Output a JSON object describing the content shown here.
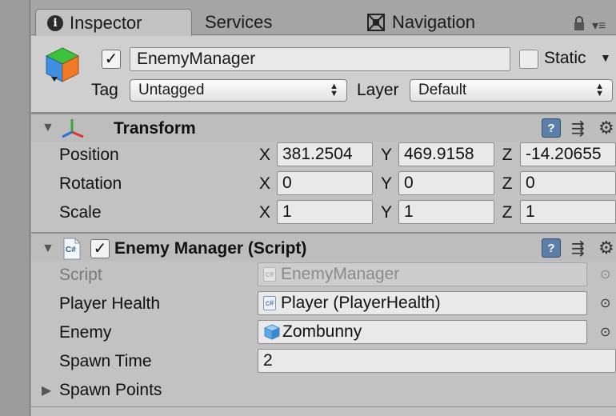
{
  "tabs": [
    {
      "label": "Inspector",
      "icon": "info-icon",
      "active": true
    },
    {
      "label": "Services",
      "active": false
    },
    {
      "label": "Navigation",
      "icon": "navigation-icon",
      "active": false
    }
  ],
  "header": {
    "active_checked": true,
    "object_name": "EnemyManager",
    "static_label": "Static",
    "static_checked": false,
    "tag_label": "Tag",
    "tag_value": "Untagged",
    "layer_label": "Layer",
    "layer_value": "Default"
  },
  "transform": {
    "title": "Transform",
    "rows": [
      {
        "label": "Position",
        "x": "381.2504",
        "y": "469.9158",
        "z": "-14.20655"
      },
      {
        "label": "Rotation",
        "x": "0",
        "y": "0",
        "z": "0"
      },
      {
        "label": "Scale",
        "x": "1",
        "y": "1",
        "z": "1"
      }
    ],
    "axes": {
      "x": "X",
      "y": "Y",
      "z": "Z"
    }
  },
  "script_component": {
    "title": "Enemy Manager (Script)",
    "enabled": true,
    "cs_badge": "C#",
    "fields": {
      "script_label": "Script",
      "script_value": "EnemyManager",
      "player_health_label": "Player Health",
      "player_health_value": "Player (PlayerHealth)",
      "enemy_label": "Enemy",
      "enemy_value": "Zombunny",
      "spawn_time_label": "Spawn Time",
      "spawn_time_value": "2",
      "spawn_points_label": "Spawn Points"
    }
  },
  "colors": {
    "panel": "#c2c2c2",
    "help_button": "#5b7fa8",
    "cube_top": "#3fc23b",
    "cube_left": "#3f8fe0",
    "cube_right": "#f07a26"
  }
}
